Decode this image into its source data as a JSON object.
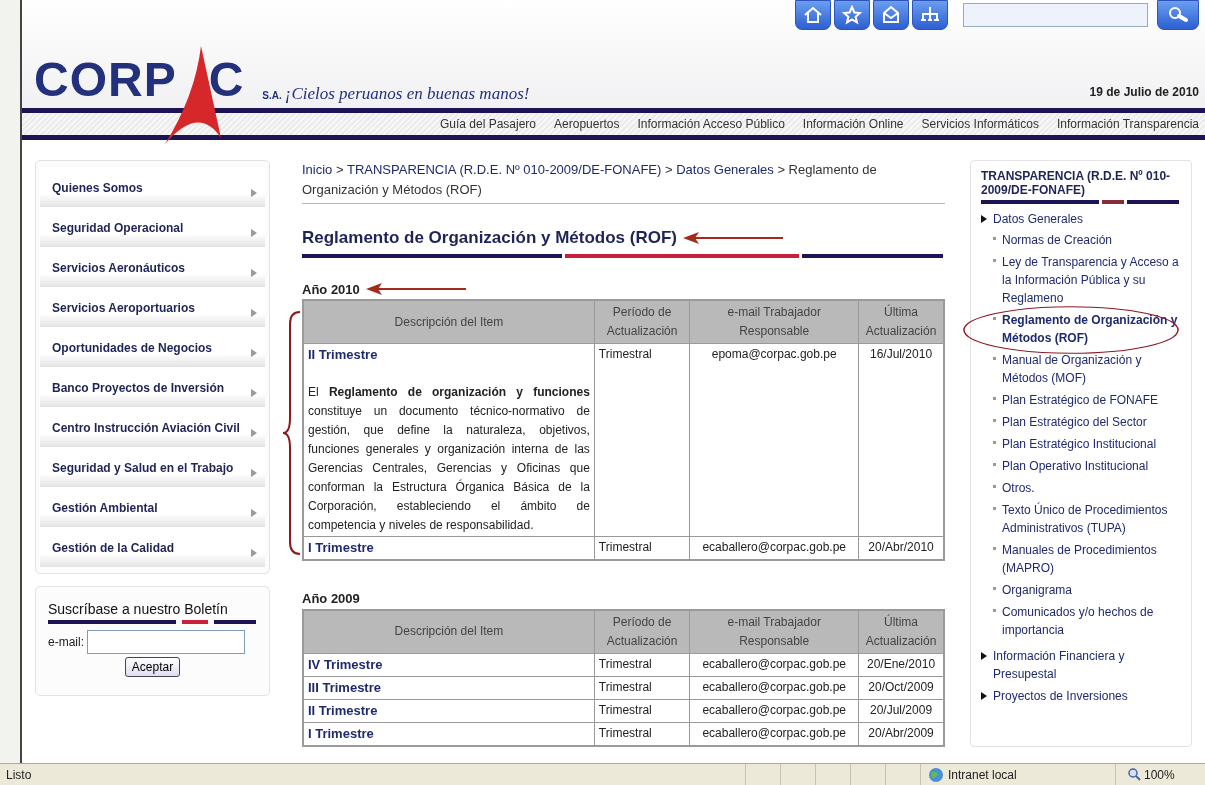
{
  "header": {
    "logo_before": "CORP",
    "logo_after": "C",
    "company_suffix": "S.A.",
    "tagline": "¡Cielos peruanos en buenas manos!",
    "date": "19 de Julio de 2010"
  },
  "nav": [
    "Guía del Pasajero",
    "Aeropuertos",
    "Información Acceso Público",
    "Información Online",
    "Servicios Informáticos",
    "Información Transparencia"
  ],
  "sidebar": {
    "items": [
      "Quienes Somos",
      "Seguridad Operacional",
      "Servicios Aeronáuticos",
      "Servicios Aeroportuarios",
      "Oportunidades de Negocios",
      "Banco Proyectos de Inversión",
      "Centro Instrucción Aviación Civil",
      "Seguridad y Salud en el Trabajo",
      "Gestión Ambiental",
      "Gestión de la Calidad"
    ],
    "newsletter": {
      "title": "Suscríbase a nuestro Boletín",
      "label": "e-mail:",
      "button": "Aceptar"
    }
  },
  "breadcrumb": {
    "separator": ">",
    "items": [
      "Inicio",
      "TRANSPARENCIA (R.D.E. Nº 010-2009/DE-FONAFE)",
      "Datos Generales",
      "Reglamento de Organización y Métodos (ROF)"
    ]
  },
  "page_title": "Reglamento de Organización y Métodos (ROF)",
  "sections": [
    {
      "year": "Año 2010",
      "columns": [
        "Descripción del Item",
        "Período de Actualización",
        "e-mail Trabajador Responsable",
        "Última Actualización"
      ],
      "rows": [
        {
          "item": "II Trimestre",
          "description": "El **Reglamento de organización y funciones** constituye un documento técnico-normativo de gestión, que define la naturaleza, objetivos, funciones generales y organización interna de las Gerencias Centrales, Gerencias y Oficinas que conforman la Estructura Órganica Básica de la Corporación, estableciendo el ámbito de competencia y niveles de responsabilidad.",
          "period": "Trimestral",
          "email": "epoma@corpac.gob.pe",
          "date": "16/Jul/2010"
        },
        {
          "item": "I Trimestre",
          "period": "Trimestral",
          "email": "ecaballero@corpac.gob.pe",
          "date": "20/Abr/2010"
        }
      ]
    },
    {
      "year": "Año 2009",
      "columns": [
        "Descripción del Item",
        "Período de Actualización",
        "e-mail Trabajador Responsable",
        "Última Actualización"
      ],
      "rows": [
        {
          "item": "IV Trimestre",
          "period": "Trimestral",
          "email": "ecaballero@corpac.gob.pe",
          "date": "20/Ene/2010"
        },
        {
          "item": "III Trimestre",
          "period": "Trimestral",
          "email": "ecaballero@corpac.gob.pe",
          "date": "20/Oct/2009"
        },
        {
          "item": "II Trimestre",
          "period": "Trimestral",
          "email": "ecaballero@corpac.gob.pe",
          "date": "20/Jul/2009"
        },
        {
          "item": "I Trimestre",
          "period": "Trimestral",
          "email": "ecaballero@corpac.gob.pe",
          "date": "20/Abr/2009"
        }
      ]
    }
  ],
  "right_panel": {
    "title": "TRANSPARENCIA (R.D.E. Nº 010-2009/DE-FONAFE)",
    "items": [
      {
        "label": "Datos Generales",
        "expanded": true,
        "children": [
          {
            "label": "Normas de Creación",
            "selected": false
          },
          {
            "label": "Ley de Transparencia y Acceso a la Información Pública y su Reglameno",
            "selected": false
          },
          {
            "label": "Reglamento de Organización y Métodos (ROF)",
            "selected": true
          },
          {
            "label": "Manual de Organización y Métodos (MOF)",
            "selected": false
          },
          {
            "label": "Plan Estratégico de FONAFE",
            "selected": false
          },
          {
            "label": "Plan Estratégico del Sector",
            "selected": false
          },
          {
            "label": "Plan Estratégico Institucional",
            "selected": false
          },
          {
            "label": "Plan Operativo Institucional",
            "selected": false
          },
          {
            "label": "Otros.",
            "selected": false
          },
          {
            "label": "Texto Único de Procedimientos Administrativos (TUPA)",
            "selected": false
          },
          {
            "label": "Manuales de Procedimientos (MAPRO)",
            "selected": false
          },
          {
            "label": "Organigrama",
            "selected": false
          },
          {
            "label": "Comunicados y/o hechos de importancia",
            "selected": false
          }
        ]
      },
      {
        "label": "Información Financiera y Presupestal"
      },
      {
        "label": "Proyectos de Inversiones"
      }
    ]
  },
  "status_bar": {
    "text": "Listo",
    "zone": "Intranet local",
    "zoom": "100%"
  }
}
